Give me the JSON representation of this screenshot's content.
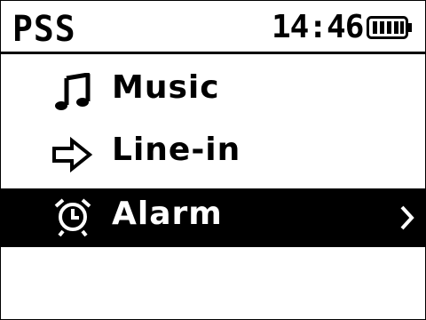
{
  "status_bar": {
    "title": "PSS",
    "time": "14:46",
    "battery_icon": "battery-full-icon"
  },
  "menu": {
    "items": [
      {
        "label": "Music",
        "icon": "music-note-icon",
        "selected": false
      },
      {
        "label": "Line-in",
        "icon": "arrow-right-icon",
        "selected": false
      },
      {
        "label": "Alarm",
        "icon": "alarm-clock-icon",
        "selected": true,
        "has_submenu": true
      }
    ]
  },
  "colors": {
    "foreground": "#000000",
    "background": "#ffffff",
    "selection_background": "#000000",
    "selection_foreground": "#ffffff"
  }
}
